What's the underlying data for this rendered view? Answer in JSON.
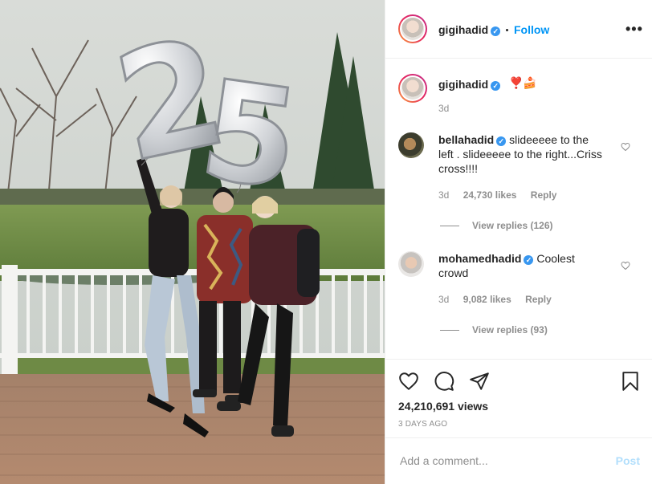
{
  "post": {
    "username": "gigihadid",
    "follow_label": "Follow",
    "more_label": "•••",
    "caption_emoji": "❣️🍰",
    "caption_time": "3d",
    "views": "24,210,691 views",
    "posted_ago": "3 DAYS AGO"
  },
  "photo": {
    "balloon_digits": [
      "2",
      "5"
    ]
  },
  "comments": [
    {
      "username": "bellahadid",
      "text": "slideeeee to the left . slideeeee to the right...Criss cross!!!!",
      "text_line1": "slideeeee to the",
      "text_line2": "left . slideeeee to the right...Criss",
      "text_line3": "cross!!!!",
      "time": "3d",
      "likes": "24,730 likes",
      "reply_label": "Reply",
      "view_replies": "View replies (126)"
    },
    {
      "username": "mohamedhadid",
      "text_line1": "Coolest",
      "text_line2": "crowd",
      "time": "3d",
      "likes": "9,082 likes",
      "reply_label": "Reply",
      "view_replies": "View replies (93)"
    }
  ],
  "composer": {
    "placeholder": "Add a comment...",
    "post_label": "Post"
  },
  "colors": {
    "accent": "#0095f6",
    "verified": "#3897f0",
    "muted": "#8e8e8e",
    "post_disabled": "#b2dffc"
  },
  "icons": {
    "like": "heart-icon",
    "comment": "comment-icon",
    "share": "paper-plane-icon",
    "save": "bookmark-icon"
  }
}
